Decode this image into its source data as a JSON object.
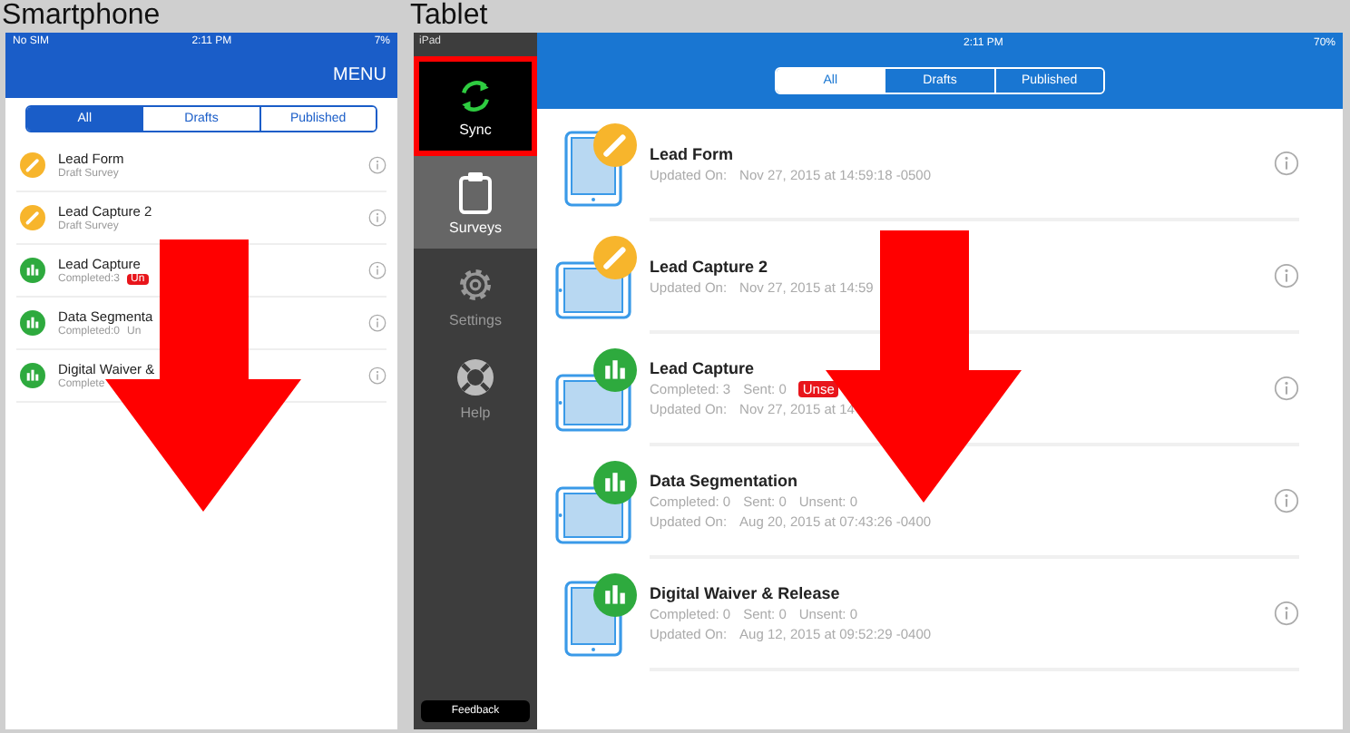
{
  "phone": {
    "label": "Smartphone",
    "status": {
      "carrier": "No SIM",
      "time": "2:11 PM",
      "battery": "7%"
    },
    "menu": "MENU",
    "tabs": [
      {
        "label": "All",
        "selected": true
      },
      {
        "label": "Drafts",
        "selected": false
      },
      {
        "label": "Published",
        "selected": false
      }
    ],
    "surveys": [
      {
        "title": "Lead Form",
        "kind": "draft",
        "lines": [
          [
            {
              "text": "Draft Survey",
              "kind": "text"
            }
          ]
        ]
      },
      {
        "title": "Lead Capture 2",
        "kind": "draft",
        "lines": [
          [
            {
              "text": "Draft Survey",
              "kind": "text"
            }
          ]
        ]
      },
      {
        "title": "Lead Capture",
        "kind": "results",
        "lines": [
          [
            {
              "text": "Completed:3",
              "kind": "text"
            },
            {
              "text": "Un",
              "kind": "badge"
            }
          ]
        ]
      },
      {
        "title": "Data Segmenta",
        "kind": "results",
        "lines": [
          [
            {
              "text": "Completed:0",
              "kind": "text"
            },
            {
              "text": "Un",
              "kind": "text"
            }
          ]
        ]
      },
      {
        "title": "Digital Waiver &",
        "kind": "results",
        "lines": [
          [
            {
              "text": "Complete",
              "kind": "text"
            }
          ]
        ]
      }
    ]
  },
  "tablet": {
    "label": "Tablet",
    "device": "iPad",
    "status": {
      "time": "2:11 PM",
      "battery": "70%"
    },
    "nav": [
      {
        "label": "Sync",
        "kind": "sync",
        "selected": false,
        "highlighted": true
      },
      {
        "label": "Surveys",
        "kind": "surveys",
        "selected": true,
        "highlighted": false
      },
      {
        "label": "Settings",
        "kind": "settings",
        "selected": false,
        "highlighted": false
      },
      {
        "label": "Help",
        "kind": "help",
        "selected": false,
        "highlighted": false
      }
    ],
    "feedback": "Feedback",
    "tabs": [
      {
        "label": "All",
        "selected": true
      },
      {
        "label": "Drafts",
        "selected": false
      },
      {
        "label": "Published",
        "selected": false
      }
    ],
    "surveys": [
      {
        "title": "Lead Form",
        "kind": "draft",
        "device": {
          "kind": "portrait"
        },
        "lines": [
          [
            {
              "text": "Updated On:",
              "kind": "text"
            },
            {
              "text": "Nov 27, 2015 at 14:59:18 -0500",
              "kind": "text"
            }
          ]
        ]
      },
      {
        "title": "Lead Capture 2",
        "kind": "draft",
        "device": {
          "kind": "landscape"
        },
        "lines": [
          [
            {
              "text": "Updated On:",
              "kind": "text"
            },
            {
              "text": "Nov 27, 2015 at 14:59",
              "kind": "text"
            }
          ]
        ]
      },
      {
        "title": "Lead Capture",
        "kind": "results",
        "device": {
          "kind": "landscape"
        },
        "lines": [
          [
            {
              "text": "Completed:  3",
              "kind": "text"
            },
            {
              "text": "Sent:  0",
              "kind": "text"
            },
            {
              "text": "Unse",
              "kind": "badge"
            }
          ],
          [
            {
              "text": "Updated On:",
              "kind": "text"
            },
            {
              "text": "Nov 27, 2015 at 14",
              "kind": "text"
            }
          ]
        ]
      },
      {
        "title": "Data Segmentation",
        "kind": "results",
        "device": {
          "kind": "landscape"
        },
        "lines": [
          [
            {
              "text": "Completed:  0",
              "kind": "text"
            },
            {
              "text": "Sent:  0",
              "kind": "text"
            },
            {
              "text": "Unsent:  0",
              "kind": "text"
            }
          ],
          [
            {
              "text": "Updated On:",
              "kind": "text"
            },
            {
              "text": "Aug 20, 2015 at 07:43:26 -0400",
              "kind": "text"
            }
          ]
        ]
      },
      {
        "title": "Digital Waiver & Release",
        "kind": "results",
        "device": {
          "kind": "portrait"
        },
        "lines": [
          [
            {
              "text": "Completed:  0",
              "kind": "text"
            },
            {
              "text": "Sent:  0",
              "kind": "text"
            },
            {
              "text": "Unsent:  0",
              "kind": "text"
            }
          ],
          [
            {
              "text": "Updated On:",
              "kind": "text"
            },
            {
              "text": "Aug 12, 2015 at 09:52:29 -0400",
              "kind": "text"
            }
          ]
        ]
      }
    ]
  }
}
